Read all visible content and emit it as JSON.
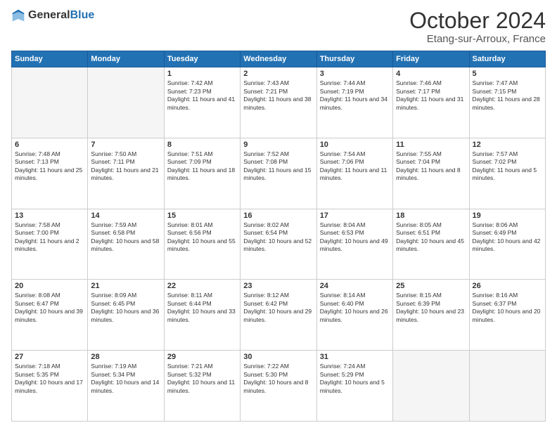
{
  "header": {
    "logo_general": "General",
    "logo_blue": "Blue",
    "title": "October 2024",
    "subtitle": "Etang-sur-Arroux, France"
  },
  "weekdays": [
    "Sunday",
    "Monday",
    "Tuesday",
    "Wednesday",
    "Thursday",
    "Friday",
    "Saturday"
  ],
  "weeks": [
    [
      {
        "day": "",
        "sunrise": "",
        "sunset": "",
        "daylight": ""
      },
      {
        "day": "",
        "sunrise": "",
        "sunset": "",
        "daylight": ""
      },
      {
        "day": "1",
        "sunrise": "Sunrise: 7:42 AM",
        "sunset": "Sunset: 7:23 PM",
        "daylight": "Daylight: 11 hours and 41 minutes."
      },
      {
        "day": "2",
        "sunrise": "Sunrise: 7:43 AM",
        "sunset": "Sunset: 7:21 PM",
        "daylight": "Daylight: 11 hours and 38 minutes."
      },
      {
        "day": "3",
        "sunrise": "Sunrise: 7:44 AM",
        "sunset": "Sunset: 7:19 PM",
        "daylight": "Daylight: 11 hours and 34 minutes."
      },
      {
        "day": "4",
        "sunrise": "Sunrise: 7:46 AM",
        "sunset": "Sunset: 7:17 PM",
        "daylight": "Daylight: 11 hours and 31 minutes."
      },
      {
        "day": "5",
        "sunrise": "Sunrise: 7:47 AM",
        "sunset": "Sunset: 7:15 PM",
        "daylight": "Daylight: 11 hours and 28 minutes."
      }
    ],
    [
      {
        "day": "6",
        "sunrise": "Sunrise: 7:48 AM",
        "sunset": "Sunset: 7:13 PM",
        "daylight": "Daylight: 11 hours and 25 minutes."
      },
      {
        "day": "7",
        "sunrise": "Sunrise: 7:50 AM",
        "sunset": "Sunset: 7:11 PM",
        "daylight": "Daylight: 11 hours and 21 minutes."
      },
      {
        "day": "8",
        "sunrise": "Sunrise: 7:51 AM",
        "sunset": "Sunset: 7:09 PM",
        "daylight": "Daylight: 11 hours and 18 minutes."
      },
      {
        "day": "9",
        "sunrise": "Sunrise: 7:52 AM",
        "sunset": "Sunset: 7:08 PM",
        "daylight": "Daylight: 11 hours and 15 minutes."
      },
      {
        "day": "10",
        "sunrise": "Sunrise: 7:54 AM",
        "sunset": "Sunset: 7:06 PM",
        "daylight": "Daylight: 11 hours and 11 minutes."
      },
      {
        "day": "11",
        "sunrise": "Sunrise: 7:55 AM",
        "sunset": "Sunset: 7:04 PM",
        "daylight": "Daylight: 11 hours and 8 minutes."
      },
      {
        "day": "12",
        "sunrise": "Sunrise: 7:57 AM",
        "sunset": "Sunset: 7:02 PM",
        "daylight": "Daylight: 11 hours and 5 minutes."
      }
    ],
    [
      {
        "day": "13",
        "sunrise": "Sunrise: 7:58 AM",
        "sunset": "Sunset: 7:00 PM",
        "daylight": "Daylight: 11 hours and 2 minutes."
      },
      {
        "day": "14",
        "sunrise": "Sunrise: 7:59 AM",
        "sunset": "Sunset: 6:58 PM",
        "daylight": "Daylight: 10 hours and 58 minutes."
      },
      {
        "day": "15",
        "sunrise": "Sunrise: 8:01 AM",
        "sunset": "Sunset: 6:56 PM",
        "daylight": "Daylight: 10 hours and 55 minutes."
      },
      {
        "day": "16",
        "sunrise": "Sunrise: 8:02 AM",
        "sunset": "Sunset: 6:54 PM",
        "daylight": "Daylight: 10 hours and 52 minutes."
      },
      {
        "day": "17",
        "sunrise": "Sunrise: 8:04 AM",
        "sunset": "Sunset: 6:53 PM",
        "daylight": "Daylight: 10 hours and 49 minutes."
      },
      {
        "day": "18",
        "sunrise": "Sunrise: 8:05 AM",
        "sunset": "Sunset: 6:51 PM",
        "daylight": "Daylight: 10 hours and 45 minutes."
      },
      {
        "day": "19",
        "sunrise": "Sunrise: 8:06 AM",
        "sunset": "Sunset: 6:49 PM",
        "daylight": "Daylight: 10 hours and 42 minutes."
      }
    ],
    [
      {
        "day": "20",
        "sunrise": "Sunrise: 8:08 AM",
        "sunset": "Sunset: 6:47 PM",
        "daylight": "Daylight: 10 hours and 39 minutes."
      },
      {
        "day": "21",
        "sunrise": "Sunrise: 8:09 AM",
        "sunset": "Sunset: 6:45 PM",
        "daylight": "Daylight: 10 hours and 36 minutes."
      },
      {
        "day": "22",
        "sunrise": "Sunrise: 8:11 AM",
        "sunset": "Sunset: 6:44 PM",
        "daylight": "Daylight: 10 hours and 33 minutes."
      },
      {
        "day": "23",
        "sunrise": "Sunrise: 8:12 AM",
        "sunset": "Sunset: 6:42 PM",
        "daylight": "Daylight: 10 hours and 29 minutes."
      },
      {
        "day": "24",
        "sunrise": "Sunrise: 8:14 AM",
        "sunset": "Sunset: 6:40 PM",
        "daylight": "Daylight: 10 hours and 26 minutes."
      },
      {
        "day": "25",
        "sunrise": "Sunrise: 8:15 AM",
        "sunset": "Sunset: 6:39 PM",
        "daylight": "Daylight: 10 hours and 23 minutes."
      },
      {
        "day": "26",
        "sunrise": "Sunrise: 8:16 AM",
        "sunset": "Sunset: 6:37 PM",
        "daylight": "Daylight: 10 hours and 20 minutes."
      }
    ],
    [
      {
        "day": "27",
        "sunrise": "Sunrise: 7:18 AM",
        "sunset": "Sunset: 5:35 PM",
        "daylight": "Daylight: 10 hours and 17 minutes."
      },
      {
        "day": "28",
        "sunrise": "Sunrise: 7:19 AM",
        "sunset": "Sunset: 5:34 PM",
        "daylight": "Daylight: 10 hours and 14 minutes."
      },
      {
        "day": "29",
        "sunrise": "Sunrise: 7:21 AM",
        "sunset": "Sunset: 5:32 PM",
        "daylight": "Daylight: 10 hours and 11 minutes."
      },
      {
        "day": "30",
        "sunrise": "Sunrise: 7:22 AM",
        "sunset": "Sunset: 5:30 PM",
        "daylight": "Daylight: 10 hours and 8 minutes."
      },
      {
        "day": "31",
        "sunrise": "Sunrise: 7:24 AM",
        "sunset": "Sunset: 5:29 PM",
        "daylight": "Daylight: 10 hours and 5 minutes."
      },
      {
        "day": "",
        "sunrise": "",
        "sunset": "",
        "daylight": ""
      },
      {
        "day": "",
        "sunrise": "",
        "sunset": "",
        "daylight": ""
      }
    ]
  ]
}
